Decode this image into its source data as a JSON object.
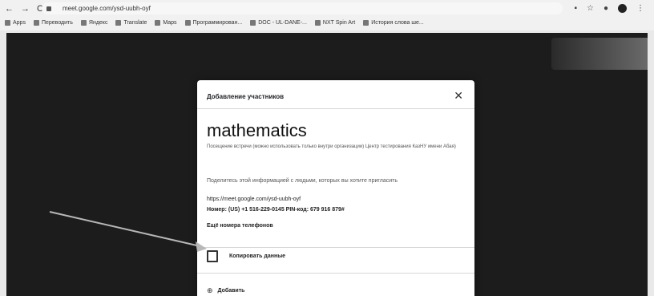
{
  "browser": {
    "url": "meet.google.com/ysd-uubh-oyf",
    "nav": {
      "back": "←",
      "forward": "→",
      "reload": "C"
    },
    "bookmarks": [
      {
        "label": "Apps"
      },
      {
        "label": "Переводить"
      },
      {
        "label": "Яндекс"
      },
      {
        "label": "Translate"
      },
      {
        "label": "Maps"
      },
      {
        "label": "Программирован..."
      },
      {
        "label": "DOC - UL-DANE-..."
      },
      {
        "label": "NXT Spin Art"
      },
      {
        "label": "История слова ше..."
      }
    ]
  },
  "dialog": {
    "title": "Добавление участников",
    "close": "✕",
    "meeting_name": "mathematics",
    "description": "Посещение встречи (можно использовать только внутри организации) Центр тестирования КазНУ имени Абая)",
    "share_text": "Поделитесь этой информацией с людьми, которых вы хотите пригласить",
    "link": "https://meet.google.com/ysd-uubh-oyf",
    "phone_line": "Номер: (US) +1 516-229-0145  PIN-код: 679 916 879#",
    "more_numbers": "Ещё номера телефонов",
    "copy_label": "Копировать данные",
    "add_label": "Добавить",
    "add_icon": "person-add-icon"
  },
  "colors": {
    "meet_bg": "#1c1c1c",
    "dialog_bg": "#ffffff",
    "text_primary": "#202124"
  }
}
